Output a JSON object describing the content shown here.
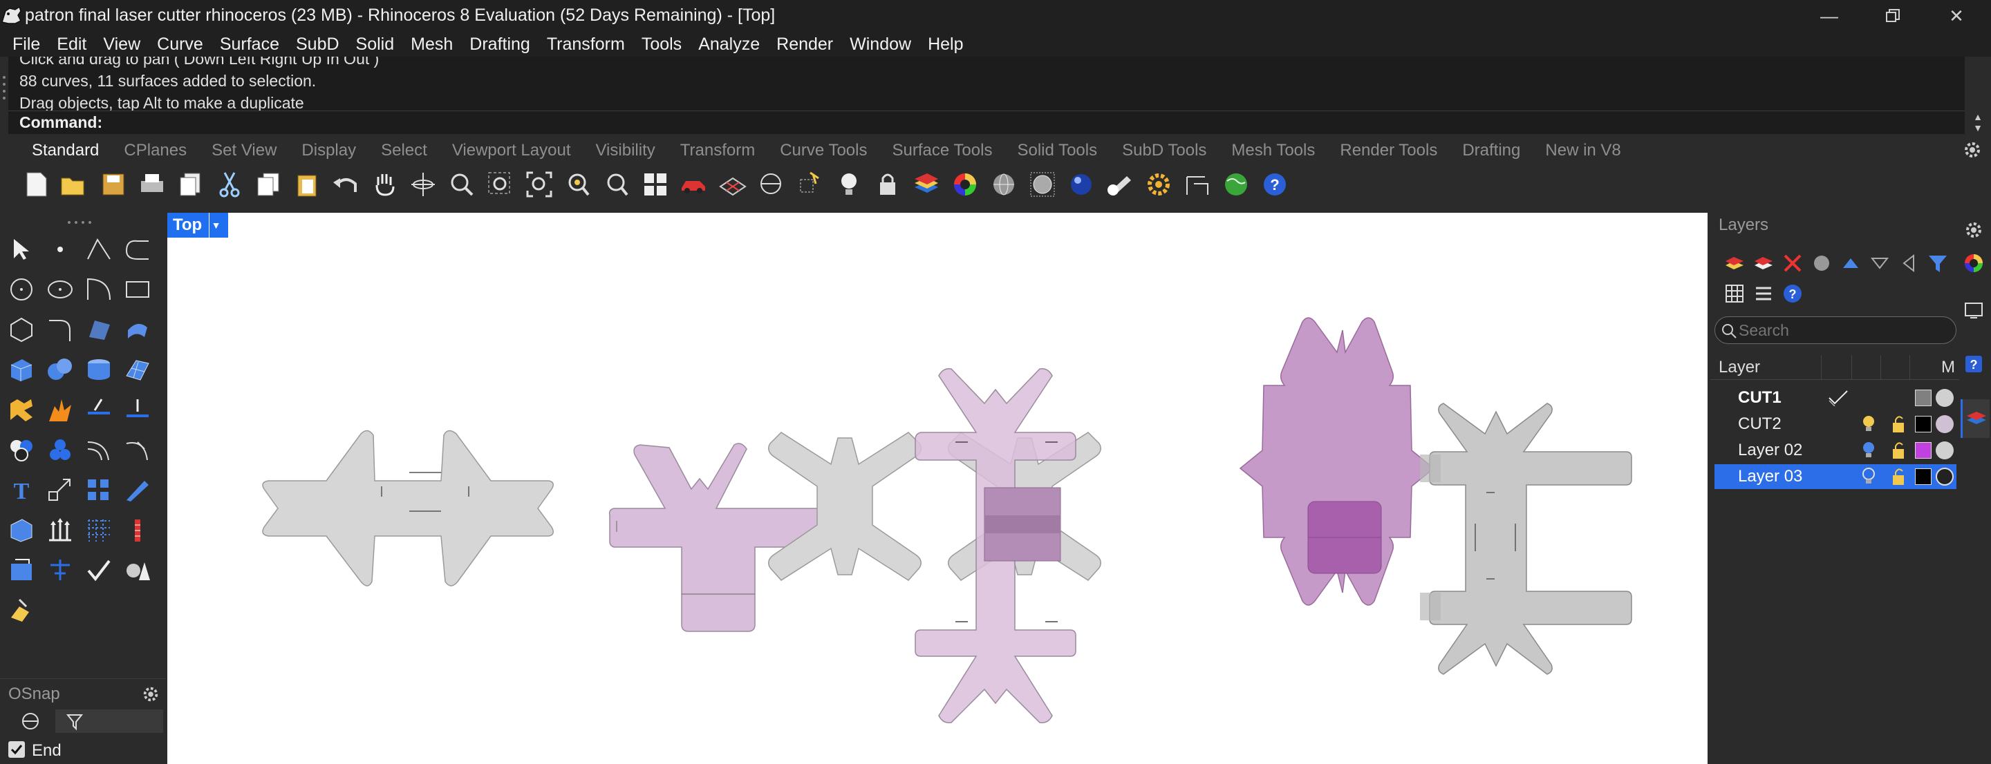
{
  "window": {
    "title": "patron final laser cutter rhinoceros (23 MB) - Rhinoceros 8 Evaluation (52 Days Remaining) - [Top]",
    "minimize_icon": "minimize-icon",
    "maximize_icon": "restore-icon",
    "close_icon": "close-icon"
  },
  "menu": [
    "File",
    "Edit",
    "View",
    "Curve",
    "Surface",
    "SubD",
    "Solid",
    "Mesh",
    "Drafting",
    "Transform",
    "Tools",
    "Analyze",
    "Render",
    "Window",
    "Help"
  ],
  "command_history": {
    "lines": [
      "Click and drag to pan ( Down  Left  Right  Up  In  Out )",
      "88 curves, 11 surfaces added to selection.",
      "Drag objects, tap Alt to make a duplicate"
    ]
  },
  "command": {
    "label": "Command:",
    "value": ""
  },
  "toolbar_tabs": [
    "Standard",
    "CPlanes",
    "Set View",
    "Display",
    "Select",
    "Viewport Layout",
    "Visibility",
    "Transform",
    "Curve Tools",
    "Surface Tools",
    "Solid Tools",
    "SubD Tools",
    "Mesh Tools",
    "Render Tools",
    "Drafting",
    "New in V8"
  ],
  "active_tab": "Standard",
  "standard_icons": [
    "new-icon",
    "open-icon",
    "save-icon",
    "print-icon",
    "import-icon",
    "cut-icon",
    "copy-icon",
    "paste-icon",
    "undo-icon",
    "pan-icon",
    "rotate-view-icon",
    "zoom-icon",
    "zoom-window-icon",
    "zoom-extents-icon",
    "zoom-selected-icon",
    "rotate-icon",
    "four-viewports-icon",
    "car-icon",
    "grid-surface-icon",
    "osnap-icon",
    "select-icon",
    "light-icon",
    "lock-icon",
    "layer-icon",
    "color-wheel-icon",
    "sphere-wire-icon",
    "mesh-sphere-icon",
    "render-sphere-icon",
    "render-icon",
    "settings-icon",
    "dimension-icon",
    "globe-icon",
    "help-icon"
  ],
  "viewport": {
    "name": "Top"
  },
  "osnap": {
    "title": "OSnap",
    "items": [
      {
        "label": "End",
        "checked": true
      }
    ]
  },
  "layers": {
    "title": "Layers",
    "search_placeholder": "Search",
    "header_layer": "Layer",
    "header_material": "M",
    "rows": [
      {
        "name": "CUT1",
        "current": true,
        "color": "#808080",
        "selected": false
      },
      {
        "name": "CUT2",
        "current": false,
        "color": "#000000",
        "selected": false
      },
      {
        "name": "Layer 02",
        "current": false,
        "color": "#c040e0",
        "selected": false
      },
      {
        "name": "Layer 03",
        "current": false,
        "color": "#000000",
        "selected": true
      }
    ]
  },
  "colors": {
    "accent": "#1f6ff0",
    "selection": "#2b6ee8",
    "shape_gray": "#d6d6d6",
    "shape_pink": "#d9bedb",
    "shape_purple": "#c69ac8",
    "shape_dark_purple": "#a860ac"
  }
}
